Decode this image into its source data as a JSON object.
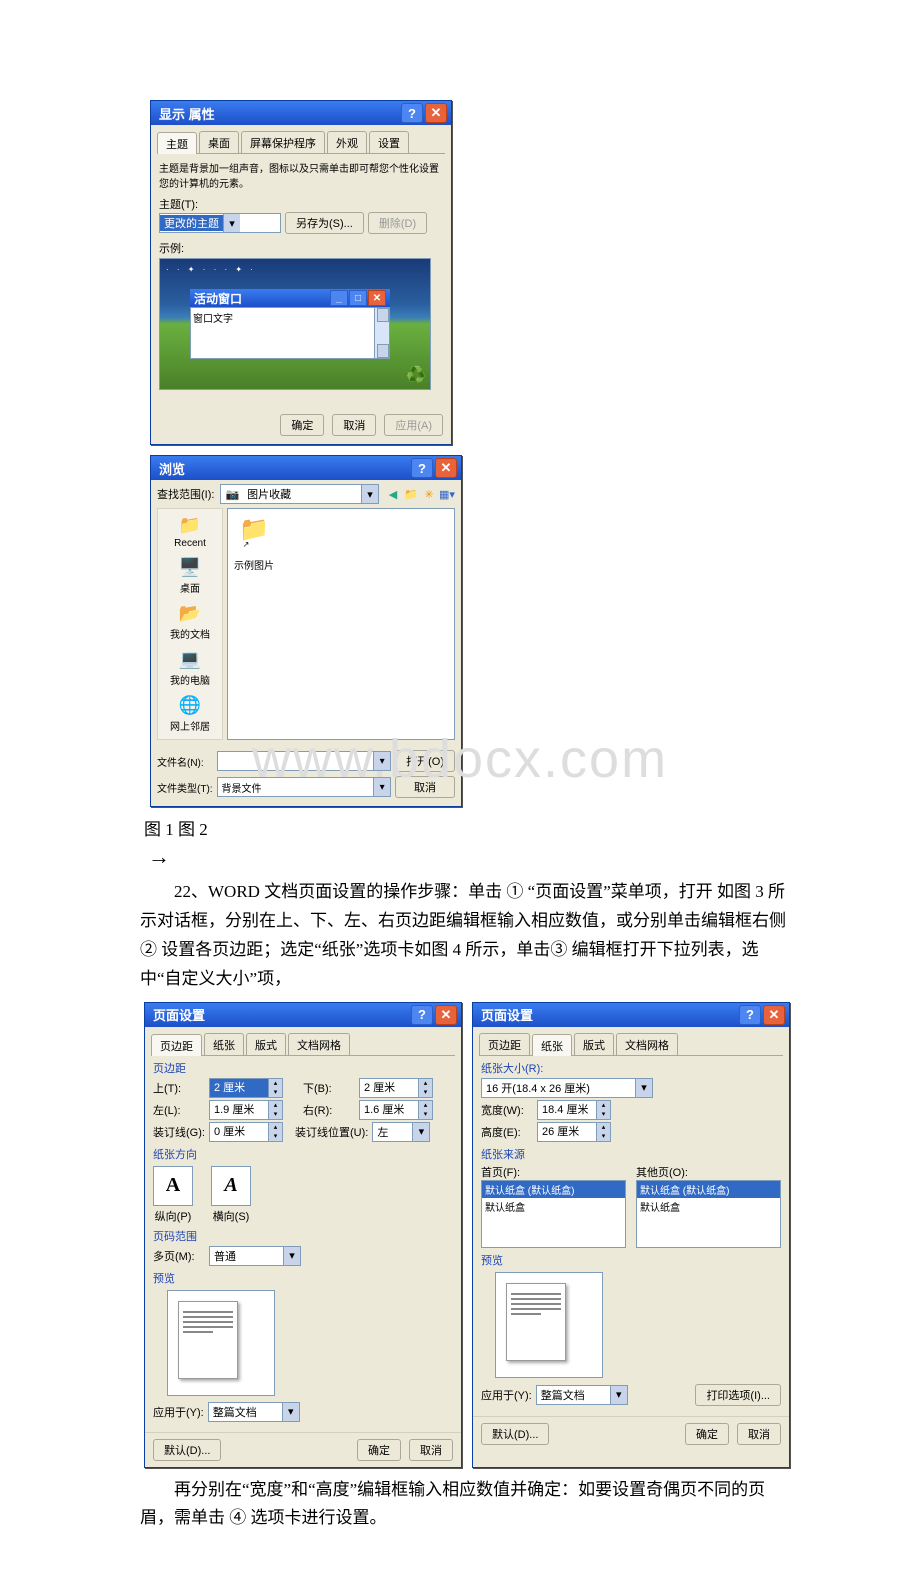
{
  "dialog1": {
    "title": "显示 属性",
    "tabs": [
      "主题",
      "桌面",
      "屏幕保护程序",
      "外观",
      "设置"
    ],
    "desc": "主题是背景加一组声音，图标以及只需单击即可帮您个性化设置您的计算机的元素。",
    "theme_label": "主题(T):",
    "theme_value": "更改的主题",
    "save_as": "另存为(S)...",
    "delete": "删除(D)",
    "sample_label": "示例:",
    "active_window": "活动窗口",
    "window_text": "窗口文字",
    "ok": "确定",
    "cancel": "取消",
    "apply": "应用(A)"
  },
  "dialog2": {
    "title": "浏览",
    "lookin_label": "查找范围(I):",
    "lookin_value": "图片收藏",
    "places": [
      {
        "icon": "📁",
        "label": "Recent"
      },
      {
        "icon": "🖥️",
        "label": "桌面"
      },
      {
        "icon": "📂",
        "label": "我的文档"
      },
      {
        "icon": "💻",
        "label": "我的电脑"
      },
      {
        "icon": "🌐",
        "label": "网上邻居"
      }
    ],
    "folder_name": "示例图片",
    "filename_label": "文件名(N):",
    "filename_value": "",
    "filetype_label": "文件类型(T):",
    "filetype_value": "背景文件",
    "open": "打开(O)",
    "cancel": "取消"
  },
  "caption_figs": "图 1         图 2",
  "para1": "22、WORD 文档页面设置的操作步骤：单击 ① “页面设置”菜单项，打开 如图 3 所示对话框，分别在上、下、左、右页边距编辑框输入相应数值，或分别单击编辑框右侧 ② 设置各页边距；选定“纸张”选项卡如图 4 所示，单击③ 编辑框打开下拉列表，选中“自定义大小”项，",
  "ps1": {
    "title": "页面设置",
    "tabs": [
      "页边距",
      "纸张",
      "版式",
      "文档网格"
    ],
    "section_margins": "页边距",
    "top_label": "上(T):",
    "top_val": "2 厘米",
    "bottom_label": "下(B):",
    "bottom_val": "2 厘米",
    "left_label": "左(L):",
    "left_val": "1.9 厘米",
    "right_label": "右(R):",
    "right_val": "1.6 厘米",
    "gutter_label": "装订线(G):",
    "gutter_val": "0 厘米",
    "gutter_pos_label": "装订线位置(U):",
    "gutter_pos_val": "左",
    "section_orient": "纸张方向",
    "portrait": "纵向(P)",
    "landscape": "横向(S)",
    "section_pages": "页码范围",
    "multi_label": "多页(M):",
    "multi_val": "普通",
    "section_preview": "预览",
    "apply_label": "应用于(Y):",
    "apply_val": "整篇文档",
    "default": "默认(D)...",
    "ok": "确定",
    "cancel": "取消"
  },
  "ps2": {
    "title": "页面设置",
    "tabs": [
      "页边距",
      "纸张",
      "版式",
      "文档网格"
    ],
    "section_size": "纸张大小(R):",
    "size_val": "16 开(18.4 x 26 厘米)",
    "width_label": "宽度(W):",
    "width_val": "18.4 厘米",
    "height_label": "高度(E):",
    "height_val": "26 厘米",
    "section_source": "纸张来源",
    "first_label": "首页(F):",
    "other_label": "其他页(O):",
    "tray_sel": "默认纸盒 (默认纸盒)",
    "tray_item": "默认纸盒",
    "section_preview": "预览",
    "apply_label": "应用于(Y):",
    "apply_val": "整篇文档",
    "print_opts": "打印选项(I)...",
    "default": "默认(D)...",
    "ok": "确定",
    "cancel": "取消"
  },
  "para2": "再分别在“宽度”和“高度”编辑框输入相应数值并确定：如要设置奇偶页不同的页眉，需单击 ④ 选项卡进行设置。",
  "watermark": "www.bdocx.com"
}
